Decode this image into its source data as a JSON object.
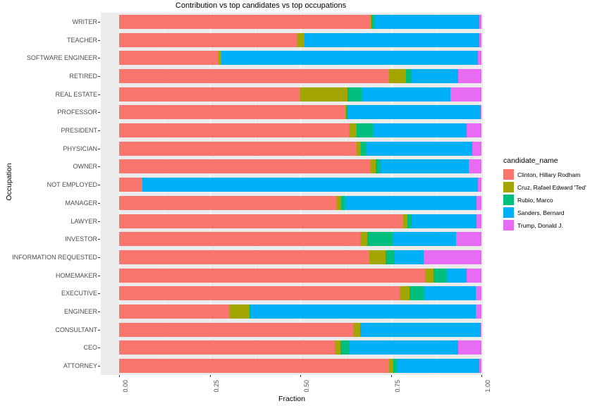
{
  "chart_data": {
    "type": "bar",
    "orientation": "horizontal",
    "stacked": true,
    "normalized": true,
    "title": "Contribution vs top candidates vs top occupations",
    "xlabel": "Fraction",
    "ylabel": "Occupation",
    "xlim": [
      0,
      1
    ],
    "xticks": [
      "0.00",
      "0.25",
      "0.50",
      "0.75",
      "1.00"
    ],
    "xtick_values": [
      0,
      0.25,
      0.5,
      0.75,
      1
    ],
    "grid": true,
    "legend_title": "candidate_name",
    "legend_position": "right",
    "panel_background": "#EBEBEB",
    "categories": [
      "WRITER",
      "TEACHER",
      "SOFTWARE ENGINEER",
      "RETIRED",
      "REAL ESTATE",
      "PROFESSOR",
      "PRESIDENT",
      "PHYSICIAN",
      "OWNER",
      "NOT EMPLOYED",
      "MANAGER",
      "LAWYER",
      "INVESTOR",
      "INFORMATION REQUESTED",
      "HOMEMAKER",
      "EXECUTIVE",
      "ENGINEER",
      "CONSULTANT",
      "CEO",
      "ATTORNEY"
    ],
    "series": [
      {
        "name": "Clinton, Hillary Rodham",
        "color": "#F8766D",
        "values": [
          0.695,
          0.49,
          0.275,
          0.745,
          0.5,
          0.625,
          0.635,
          0.655,
          0.695,
          0.065,
          0.6,
          0.785,
          0.665,
          0.69,
          0.845,
          0.775,
          0.305,
          0.645,
          0.595,
          0.745
        ]
      },
      {
        "name": "Cruz, Rafael Edward 'Ted'",
        "color": "#A3A500",
        "values": [
          0.002,
          0.022,
          0.008,
          0.046,
          0.13,
          0.002,
          0.021,
          0.012,
          0.013,
          0.0,
          0.013,
          0.01,
          0.02,
          0.045,
          0.022,
          0.026,
          0.055,
          0.02,
          0.016,
          0.011
        ]
      },
      {
        "name": "Rubio, Marco",
        "color": "#00BF7D",
        "values": [
          0.007,
          0.0,
          0.0,
          0.016,
          0.04,
          0.006,
          0.046,
          0.015,
          0.012,
          0.0,
          0.01,
          0.012,
          0.07,
          0.025,
          0.036,
          0.04,
          0.003,
          0.0,
          0.026,
          0.01
        ]
      },
      {
        "name": "Sanders, Bernard",
        "color": "#00B0F6"
      },
      {
        "name": "Trump, Donald J.",
        "color": "#E76BF3",
        "values": [
          0.006,
          0.006,
          0.009,
          0.064,
          0.085,
          0.002,
          0.04,
          0.025,
          0.035,
          0.009,
          0.014,
          0.014,
          0.07,
          0.159,
          0.04,
          0.016,
          0.016,
          0.002,
          0.064,
          0.006
        ]
      }
    ],
    "sanders_values": [
      0.29,
      0.482,
      0.708,
      0.129,
      0.245,
      0.365,
      0.258,
      0.293,
      0.245,
      0.926,
      0.363,
      0.179,
      0.175,
      0.081,
      0.057,
      0.143,
      0.621,
      0.333,
      0.299,
      0.228
    ]
  }
}
